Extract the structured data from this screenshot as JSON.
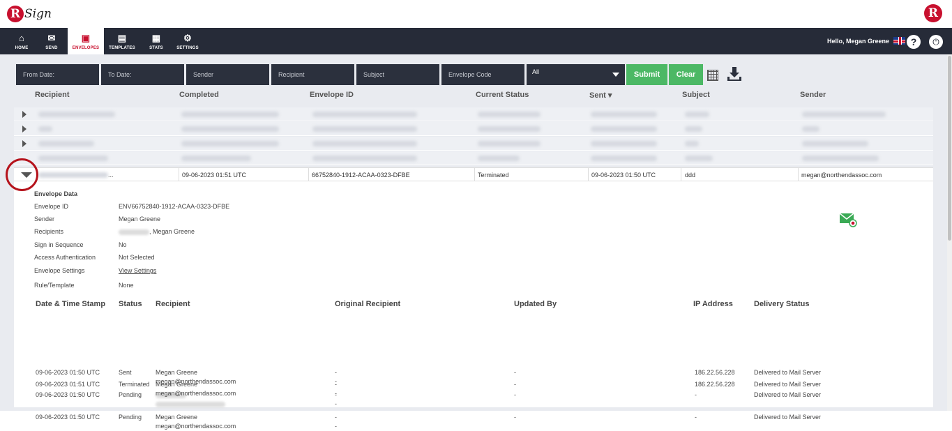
{
  "app": {
    "logo_initial": "R",
    "logo_text": "Sign"
  },
  "nav": {
    "items": [
      {
        "label": "HOME",
        "icon": "home-icon"
      },
      {
        "label": "SEND",
        "icon": "envelope-icon"
      },
      {
        "label": "ENVELOPES",
        "icon": "inbox-icon"
      },
      {
        "label": "TEMPLATES",
        "icon": "template-icon"
      },
      {
        "label": "STATS",
        "icon": "briefcase-icon"
      },
      {
        "label": "SETTINGS",
        "icon": "gear-icon"
      }
    ],
    "active": "ENVELOPES",
    "greeting": "Hello, Megan Greene",
    "help_label": "?",
    "power_label": "⏻"
  },
  "filters": {
    "from_date": "From Date:",
    "to_date": "To Date:",
    "sender": "Sender",
    "recipient": "Recipient",
    "subject": "Subject",
    "envelope_code": "Envelope Code",
    "status_selected": "All",
    "submit_label": "Submit",
    "clear_label": "Clear"
  },
  "table": {
    "headers": [
      "Recipient",
      "Completed",
      "Envelope ID",
      "Current Status",
      "Sent",
      "Subject",
      "Sender"
    ],
    "sort_indicator": "▾",
    "expanded_row": {
      "recipient": "...",
      "completed": "09-06-2023 01:51 UTC",
      "envelope_id": "66752840-1912-ACAA-0323-DFBE",
      "status": "Terminated",
      "sent": "09-06-2023 01:50 UTC",
      "subject": "ddd",
      "sender": "megan@northendassoc.com"
    }
  },
  "envelope_data": {
    "title": "Envelope Data",
    "rows": [
      {
        "label": "Envelope ID",
        "value": "ENV66752840-1912-ACAA-0323-DFBE"
      },
      {
        "label": "Sender",
        "value": "Megan Greene"
      },
      {
        "label": "Recipients",
        "value": ", Megan Greene"
      },
      {
        "label": "Sign in Sequence",
        "value": "No"
      },
      {
        "label": "Access Authentication",
        "value": "Not Selected"
      },
      {
        "label": "Envelope Settings",
        "value": "View Settings"
      },
      {
        "label": "Rule/Template",
        "value": "None"
      }
    ]
  },
  "history": {
    "headers": [
      "Date & Time Stamp",
      "Status",
      "Recipient",
      "Original Recipient",
      "Updated By",
      "IP Address",
      "Delivery Status"
    ],
    "rows": [
      {
        "date": "09-06-2023 01:50 UTC",
        "status": "Sent",
        "name": "Megan Greene",
        "email": "megan@northendassoc.com",
        "orig1": "-",
        "orig2": "-",
        "updated": "-",
        "ip": "186.22.56.228",
        "delivery": "Delivered to Mail Server"
      },
      {
        "date": "09-06-2023 01:50 UTC",
        "status": "Pending",
        "name": "",
        "email": "",
        "orig1": "-",
        "orig2": "-",
        "updated": "-",
        "ip": "-",
        "delivery": "Delivered to Mail Server"
      },
      {
        "date": "09-06-2023 01:50 UTC",
        "status": "Pending",
        "name": "Megan Greene",
        "email": "megan@northendassoc.com",
        "orig1": "-",
        "orig2": "-",
        "updated": "-",
        "ip": "-",
        "delivery": "Delivered to Mail Server"
      },
      {
        "date": "09-06-2023 01:51 UTC",
        "status": "Terminated",
        "name": "Megan Greene",
        "email": "megan@northendassoc.com",
        "orig1": "-",
        "orig2": "-",
        "updated": "-",
        "ip": "186.22.56.228",
        "delivery": "Delivered to Mail Server"
      }
    ]
  },
  "colors": {
    "accent": "#c8102e",
    "nav_bg": "#262b38",
    "green": "#4cb865"
  }
}
